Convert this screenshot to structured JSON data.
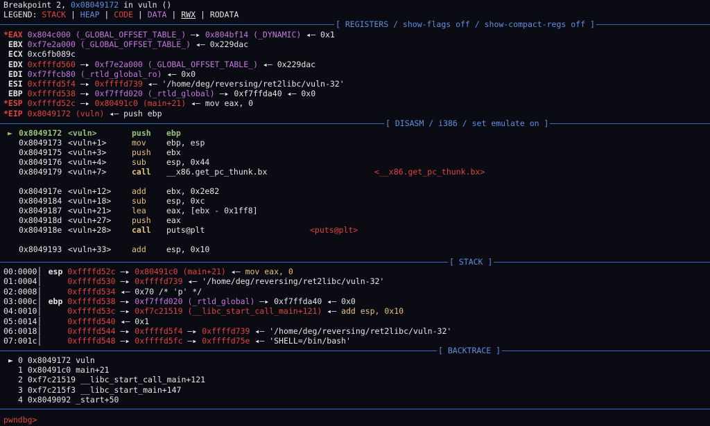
{
  "header": {
    "breakpoint_prefix": "Breakpoint 2, ",
    "breakpoint_addr": "0x08049172",
    "breakpoint_suffix": " in vuln ()",
    "legend_label": "LEGEND: ",
    "legend": [
      "STACK",
      "HEAP",
      "CODE",
      "DATA",
      "RWX",
      "RODATA"
    ]
  },
  "sections": {
    "registers": "[ REGISTERS / show-flags off / show-compact-regs off ]",
    "disasm": "[ DISASM / i386 / set emulate on ]",
    "stack": "[ STACK ]",
    "backtrace": "[ BACKTRACE ]"
  },
  "registers": [
    {
      "name": "*EAX",
      "modified": true,
      "value": "0x804c000 (_GLOBAL_OFFSET_TABLE_)",
      "chain": [
        "0x804bf14 (_DYNAMIC)",
        "0x1"
      ]
    },
    {
      "name": " EBX",
      "modified": false,
      "value": "0xf7e2a000 (_GLOBAL_OFFSET_TABLE_)",
      "chain": [
        "0x229dac"
      ]
    },
    {
      "name": " ECX",
      "modified": false,
      "value": "0xc6fb089c",
      "chain": []
    },
    {
      "name": " EDX",
      "modified": false,
      "value": "0xffffd560",
      "chain": [
        "0xf7e2a000 (_GLOBAL_OFFSET_TABLE_)",
        "0x229dac"
      ]
    },
    {
      "name": " EDI",
      "modified": false,
      "value": "0xf7ffcb80 (_rtld_global_ro)",
      "chain": [
        "0x0"
      ]
    },
    {
      "name": " ESI",
      "modified": false,
      "value": "0xffffd5f4",
      "chain": [
        "0xffffd739",
        "'/home/deg/reversing/ret2libc/vuln-32'"
      ]
    },
    {
      "name": " EBP",
      "modified": false,
      "value": "0xffffd538",
      "chain": [
        "0xf7ffd020 (_rtld_global)",
        "0xf7ffda40",
        "0x0"
      ]
    },
    {
      "name": "*ESP",
      "modified": true,
      "value": "0xffffd52c",
      "chain": [
        "0x80491c0 (main+21)",
        "mov eax, 0"
      ]
    },
    {
      "name": "*EIP",
      "modified": true,
      "value": "0x8049172 (vuln)",
      "chain": [
        "push ebp"
      ]
    }
  ],
  "disasm": [
    {
      "current": true,
      "marker": "►",
      "addr": "0x8049172",
      "sym": "<vuln>",
      "mnem": "push",
      "ops": "ebp",
      "target": ""
    },
    {
      "current": false,
      "marker": "",
      "addr": "0x8049173",
      "sym": "<vuln+1>",
      "mnem": "mov",
      "ops": "ebp, esp",
      "target": ""
    },
    {
      "current": false,
      "marker": "",
      "addr": "0x8049175",
      "sym": "<vuln+3>",
      "mnem": "push",
      "ops": "ebx",
      "target": ""
    },
    {
      "current": false,
      "marker": "",
      "addr": "0x8049176",
      "sym": "<vuln+4>",
      "mnem": "sub",
      "ops": "esp, 0x44",
      "target": ""
    },
    {
      "current": false,
      "marker": "",
      "addr": "0x8049179",
      "sym": "<vuln+7>",
      "mnem": "call",
      "ops": "__x86.get_pc_thunk.bx",
      "target": "<__x86.get_pc_thunk.bx>"
    },
    {
      "current": false,
      "marker": "",
      "addr": "0x804917e",
      "sym": "<vuln+12>",
      "mnem": "add",
      "ops": "ebx, 0x2e82",
      "target": ""
    },
    {
      "current": false,
      "marker": "",
      "addr": "0x8049184",
      "sym": "<vuln+18>",
      "mnem": "sub",
      "ops": "esp, 0xc",
      "target": ""
    },
    {
      "current": false,
      "marker": "",
      "addr": "0x8049187",
      "sym": "<vuln+21>",
      "mnem": "lea",
      "ops": "eax, [ebx - 0x1ff8]",
      "target": ""
    },
    {
      "current": false,
      "marker": "",
      "addr": "0x804918d",
      "sym": "<vuln+27>",
      "mnem": "push",
      "ops": "eax",
      "target": ""
    },
    {
      "current": false,
      "marker": "",
      "addr": "0x804918e",
      "sym": "<vuln+28>",
      "mnem": "call",
      "ops": "puts@plt",
      "target": "<puts@plt>"
    },
    {
      "current": false,
      "marker": "",
      "addr": "0x8049193",
      "sym": "<vuln+33>",
      "mnem": "add",
      "ops": "esp, 0x10",
      "target": ""
    }
  ],
  "stack": [
    {
      "offset": "00:0000",
      "reg": "esp",
      "addr": "0xffffd52c",
      "chain": [
        "0x80491c0 (main+21)",
        "mov eax, 0"
      ]
    },
    {
      "offset": "01:0004",
      "reg": "",
      "addr": "0xffffd530",
      "chain": [
        "0xffffd739",
        "'/home/deg/reversing/ret2libc/vuln-32'"
      ]
    },
    {
      "offset": "02:0008",
      "reg": "",
      "addr": "0xffffd534",
      "chain": [
        "0x70 /* 'p' */"
      ]
    },
    {
      "offset": "03:000c",
      "reg": "ebp",
      "addr": "0xffffd538",
      "chain": [
        "0xf7ffd020 (_rtld_global)",
        "0xf7ffda40",
        "0x0"
      ]
    },
    {
      "offset": "04:0010",
      "reg": "",
      "addr": "0xffffd53c",
      "chain": [
        "0xf7c21519 (__libc_start_call_main+121)",
        "add esp, 0x10"
      ]
    },
    {
      "offset": "05:0014",
      "reg": "",
      "addr": "0xffffd540",
      "chain": [
        "0x1"
      ]
    },
    {
      "offset": "06:0018",
      "reg": "",
      "addr": "0xffffd544",
      "chain": [
        "0xffffd5f4",
        "0xffffd739",
        "'/home/deg/reversing/ret2libc/vuln-32'"
      ]
    },
    {
      "offset": "07:001c",
      "reg": "",
      "addr": "0xffffd548",
      "chain": [
        "0xffffd5fc",
        "0xffffd75e",
        "'SHELL=/bin/bash'"
      ]
    }
  ],
  "backtrace": [
    {
      "marker": "►",
      "index": "0",
      "addr": "0x8049172",
      "sym": "vuln"
    },
    {
      "marker": "",
      "index": "1",
      "addr": "0x80491c0",
      "sym": "main+21"
    },
    {
      "marker": "",
      "index": "2",
      "addr": "0xf7c21519",
      "sym": "__libc_start_call_main+121"
    },
    {
      "marker": "",
      "index": "3",
      "addr": "0xf7c215f3",
      "sym": "__libc_start_main+147"
    },
    {
      "marker": "",
      "index": "4",
      "addr": "0x8049092",
      "sym": "_start+50"
    }
  ],
  "prompt": "pwndbg>",
  "colors": {
    "background": "#0b0b14",
    "stack": "#e0453c",
    "heap": "#5f8fe0",
    "code": "#e0453c",
    "data": "#c678dd",
    "rwx": "#e6e6e6",
    "rodata": "#e6e6e6"
  }
}
